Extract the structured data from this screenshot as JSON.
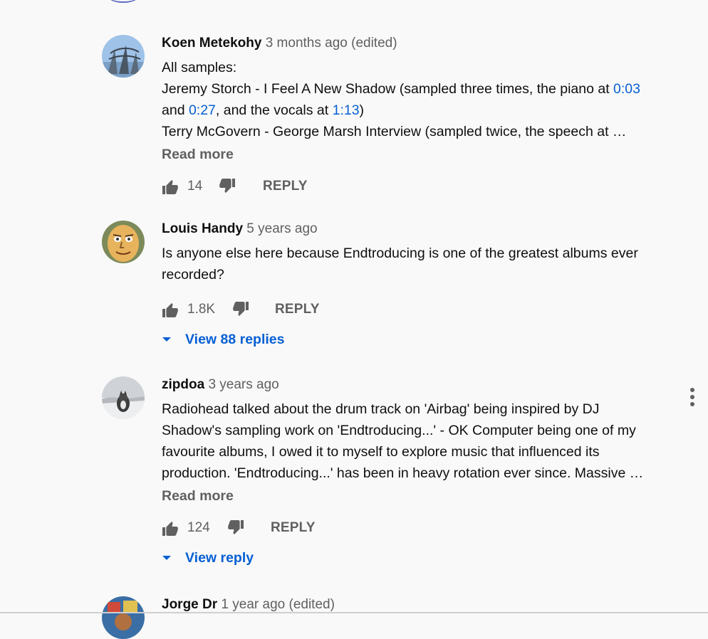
{
  "comments": [
    {
      "author": "Koen Metekohy",
      "meta": "3 months ago (edited)",
      "line1": "All samples:",
      "line2_a": "Jeremy Storch - I Feel A New Shadow (sampled three times, the piano at ",
      "ts1": "0:03",
      "line3_a": "and ",
      "ts2": "0:27",
      "line3_b": ", and the vocals at ",
      "ts3": "1:13",
      "line3_c": ")",
      "line4": "Terry McGovern - George Marsh Interview (sampled twice, the speech at …",
      "read_more": "Read more",
      "likes": "14",
      "reply": "REPLY"
    },
    {
      "author": "Louis Handy",
      "meta": "5 years ago",
      "line1": "Is anyone else here because Endtroducing is one of the greatest albums ever",
      "line2": "recorded?",
      "likes": "1.8K",
      "reply": "REPLY",
      "view_replies": "View 88 replies"
    },
    {
      "author": "zipdoa",
      "meta": "3 years ago",
      "line1": "Radiohead talked about the drum track on 'Airbag' being inspired by DJ",
      "line2": "Shadow's sampling work on 'Endtroducing...' - OK Computer being one of my",
      "line3": "favourite albums, I owed it to myself to explore music that influenced its",
      "line4": "production. 'Endtroducing...' has been in heavy rotation ever since. Massive …",
      "read_more": "Read more",
      "likes": "124",
      "reply": "REPLY",
      "view_replies": "View reply"
    },
    {
      "author": "Jorge Dr",
      "meta": "1 year ago (edited)"
    }
  ],
  "colors": {
    "link": "#065fd4",
    "secondary": "#606060",
    "background": "#f9f9f9"
  }
}
